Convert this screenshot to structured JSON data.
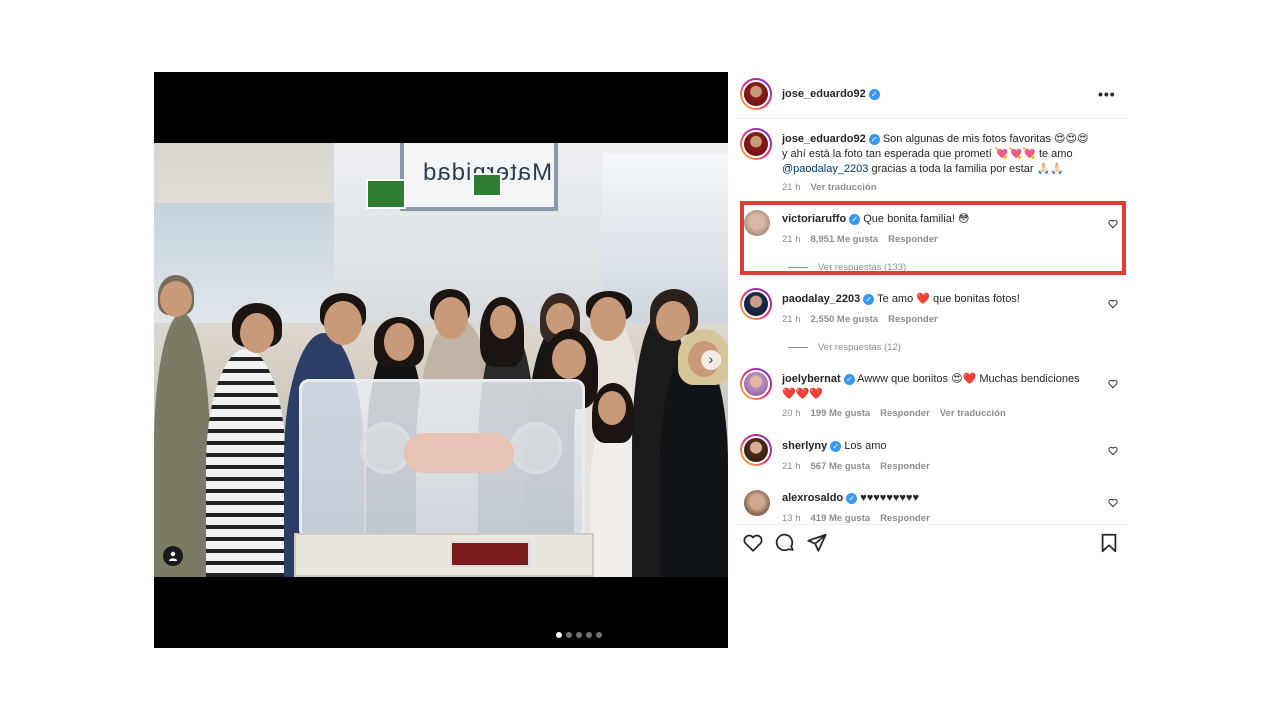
{
  "post": {
    "author": "jose_eduardo92",
    "more_label": "•••",
    "caption_lines": [
      "Son algunas de mis fotos favoritas 😍😍😍",
      "y ahí está la foto tan esperada que prometí 💘💘💘 te amo",
      "@paodalay_2203 gracias a toda la familia por estar 🙏🏻🙏🏻"
    ],
    "caption_mention": "@paodalay_2203",
    "caption_line3_rest": " gracias a toda la familia por estar 🙏🏻🙏🏻",
    "caption_time": "21 h",
    "caption_translate": "Ver traducción",
    "sign_text": "Maternidad",
    "carousel_next": "›",
    "carousel_pages": 5,
    "carousel_active": 1
  },
  "comments": [
    {
      "user": "victoriaruffo",
      "verified": true,
      "text": "Que bonita familia! 😳",
      "time": "21 h",
      "likes": "8,951 Me gusta",
      "reply": "Responder",
      "view_replies": "Ver respuestas (133)"
    },
    {
      "user": "paodalay_2203",
      "verified": true,
      "text": "Te amo ❤️ que bonitas fotos!",
      "time": "21 h",
      "likes": "2,550 Me gusta",
      "reply": "Responder",
      "view_replies": "Ver respuestas (12)"
    },
    {
      "user": "joelybernat",
      "verified": true,
      "text": "Awww que bonitos 😍❤️ Muchas bendiciones",
      "text2": "❤️❤️❤️",
      "time": "20 h",
      "likes": "199 Me gusta",
      "reply": "Responder",
      "translate": "Ver traducción"
    },
    {
      "user": "sherlyny",
      "verified": true,
      "text": "Los amo",
      "time": "21 h",
      "likes": "567 Me gusta",
      "reply": "Responder"
    },
    {
      "user": "alexrosaldo",
      "verified": true,
      "text": "♥♥♥♥♥♥♥♥♥",
      "time": "13 h",
      "likes": "419 Me gusta",
      "reply": "Responder"
    }
  ],
  "icons": {
    "like": "heart-icon",
    "comment": "comment-icon",
    "share": "share-icon",
    "save": "bookmark-icon"
  },
  "colors": {
    "highlight": "#e53935",
    "verified": "#3897f0",
    "muted": "#8e8e8e"
  }
}
